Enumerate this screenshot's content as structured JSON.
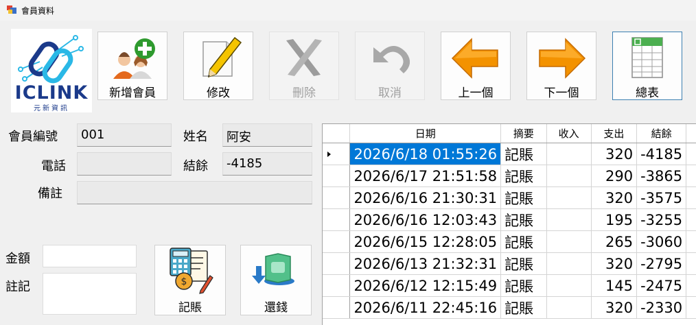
{
  "window": {
    "title": "會員資料"
  },
  "logo": {
    "brand": "ICLINK",
    "subtitle": "元新資訊"
  },
  "toolbar": {
    "add": "新增會員",
    "edit": "修改",
    "delete": "刪除",
    "cancel": "取消",
    "prev": "上一個",
    "next": "下一個",
    "summary": "總表"
  },
  "form": {
    "member_no_label": "會員編號",
    "member_no": "001",
    "name_label": "姓名",
    "name": "阿安",
    "phone_label": "電話",
    "phone": "",
    "balance_label": "結餘",
    "balance": "-4185",
    "note_label": "備註",
    "note": "",
    "amount_label": "金額",
    "amount": "",
    "remark_label": "註記",
    "remark": ""
  },
  "actions": {
    "record": "記賬",
    "repay": "還錢"
  },
  "grid": {
    "headers": [
      "日期",
      "摘要",
      "收入",
      "支出",
      "結餘"
    ],
    "rows": [
      {
        "date": "2026/6/18 01:55:26",
        "summary": "記賬",
        "income": "",
        "expense": "320",
        "balance": "-4185"
      },
      {
        "date": "2026/6/17 21:51:58",
        "summary": "記賬",
        "income": "",
        "expense": "290",
        "balance": "-3865"
      },
      {
        "date": "2026/6/16 21:30:31",
        "summary": "記賬",
        "income": "",
        "expense": "320",
        "balance": "-3575"
      },
      {
        "date": "2026/6/16 12:03:43",
        "summary": "記賬",
        "income": "",
        "expense": "195",
        "balance": "-3255"
      },
      {
        "date": "2026/6/15 12:28:05",
        "summary": "記賬",
        "income": "",
        "expense": "265",
        "balance": "-3060"
      },
      {
        "date": "2026/6/13 21:32:31",
        "summary": "記賬",
        "income": "",
        "expense": "320",
        "balance": "-2795"
      },
      {
        "date": "2026/6/12 12:15:49",
        "summary": "記賬",
        "income": "",
        "expense": "145",
        "balance": "-2475"
      },
      {
        "date": "2026/6/11 22:45:16",
        "summary": "記賬",
        "income": "",
        "expense": "320",
        "balance": "-2330"
      }
    ]
  },
  "colors": {
    "selection": "#0078d7",
    "accent_orange": "#f39200",
    "logo_blue": "#1b3a8a",
    "logo_cyan": "#2ab8e6"
  }
}
